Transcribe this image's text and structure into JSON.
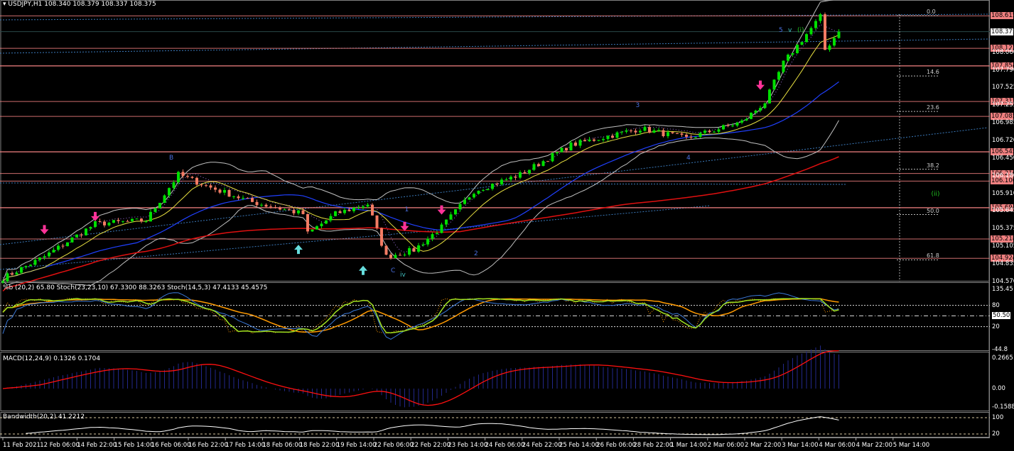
{
  "header": {
    "symbol": "USDJPY,H1",
    "open": "108.340",
    "high": "108.379",
    "low": "108.337",
    "close": "108.375"
  },
  "indicators": {
    "stoch_label": "%b (20,2) 65.80  Stoch(23,23,10) 67.3300 88.3263  Stoch(14,5,3) 47.4133 45.4575",
    "macd_label": "MACD(12,24,9) 0.1326 0.1704",
    "bandwidth_label": "Bandwidth(20,2) 41.2212"
  },
  "colors": {
    "bull": "#00e000",
    "bear": "#f47c64",
    "level": "#f08080",
    "ma_fast": "#e8e040",
    "ma_mid": "#2040ff",
    "ma_slow": "#e01010",
    "bands": "#c0c0c0",
    "stoch_k": "#a0e020",
    "stoch_d": "#ff9a00",
    "macd_hist": "#22288a",
    "macd_signal": "#ff1010",
    "arrow_down": "#ff3399",
    "arrow_up": "#66dddd"
  },
  "chart_data": {
    "type": "candlestick",
    "title": "USDJPY,H1",
    "ylim": [
      104.57,
      108.7
    ],
    "bars": 182,
    "close_path": [
      {
        "bar": 0,
        "price": 104.62
      },
      {
        "bar": 9,
        "price": 104.95
      },
      {
        "bar": 20,
        "price": 105.45
      },
      {
        "bar": 31,
        "price": 105.5
      },
      {
        "bar": 38,
        "price": 106.2
      },
      {
        "bar": 45,
        "price": 106.0
      },
      {
        "bar": 54,
        "price": 105.78
      },
      {
        "bar": 65,
        "price": 105.6
      },
      {
        "bar": 66,
        "price": 105.3
      },
      {
        "bar": 72,
        "price": 105.6
      },
      {
        "bar": 79,
        "price": 105.75
      },
      {
        "bar": 83,
        "price": 104.95
      },
      {
        "bar": 89,
        "price": 105.05
      },
      {
        "bar": 95,
        "price": 105.4
      },
      {
        "bar": 102,
        "price": 105.95
      },
      {
        "bar": 112,
        "price": 106.2
      },
      {
        "bar": 123,
        "price": 106.65
      },
      {
        "bar": 138,
        "price": 106.9
      },
      {
        "bar": 148,
        "price": 106.75
      },
      {
        "bar": 160,
        "price": 107.0
      },
      {
        "bar": 165,
        "price": 107.3
      },
      {
        "bar": 169,
        "price": 107.9
      },
      {
        "bar": 177,
        "price": 108.6
      },
      {
        "bar": 178,
        "price": 108.1
      },
      {
        "bar": 181,
        "price": 108.375
      }
    ],
    "price_ticks": [
      "108.375",
      "108.060",
      "107.790",
      "107.525",
      "107.255",
      "106.985",
      "106.720",
      "106.450",
      "106.180",
      "105.910",
      "105.645",
      "105.375",
      "105.105",
      "104.835",
      "104.570"
    ],
    "levels": [
      "108.615",
      "108.122",
      "107.854",
      "107.312",
      "107.085",
      "106.545",
      "106.216",
      "106.100",
      "105.694",
      "105.218",
      "104.924"
    ],
    "current_price": "108.375",
    "fib_levels": [
      "0.0",
      "14.6",
      "23.6",
      "38.2",
      "50.0",
      "61.8"
    ],
    "fib_prices": [
      108.62,
      107.7,
      107.16,
      106.28,
      105.59,
      104.9
    ],
    "time_labels": [
      "11 Feb 2021",
      "12 Feb 06:00",
      "14 Feb 22:00",
      "15 Feb 14:00",
      "16 Feb 06:00",
      "16 Feb 22:00",
      "17 Feb 14:00",
      "18 Feb 06:00",
      "18 Feb 22:00",
      "19 Feb 14:00",
      "22 Feb 06:00",
      "22 Feb 22:00",
      "23 Feb 14:00",
      "24 Feb 06:00",
      "24 Feb 22:00",
      "25 Feb 14:00",
      "26 Feb 06:00",
      "28 Feb 22:00",
      "1 Mar 14:00",
      "2 Mar 06:00",
      "2 Mar 22:00",
      "3 Mar 14:00",
      "4 Mar 06:00",
      "4 Mar 22:00",
      "5 Mar 14:00"
    ],
    "wave_labels": [
      {
        "text": "B",
        "bar": 36,
        "price": 106.5,
        "color": "#4a6fe0"
      },
      {
        "text": "1",
        "bar": 87,
        "price": 105.72,
        "color": "#4a6fe0"
      },
      {
        "text": "2",
        "bar": 102,
        "price": 105.05,
        "color": "#4a6fe0"
      },
      {
        "text": "C",
        "bar": 84,
        "price": 104.79,
        "color": "#4a6fe0"
      },
      {
        "text": "iv",
        "bar": 86,
        "price": 104.72,
        "color": "#40c0c0"
      },
      {
        "text": "3",
        "bar": 137,
        "price": 107.3,
        "color": "#4a6fe0"
      },
      {
        "text": "4",
        "bar": 148,
        "price": 106.5,
        "color": "#4a6fe0"
      },
      {
        "text": "5",
        "bar": 168,
        "price": 108.45,
        "color": "#4a6fe0"
      },
      {
        "text": "v",
        "bar": 170,
        "price": 108.45,
        "color": "#40c0c0"
      },
      {
        "text": "(i)",
        "bar": 172,
        "price": 108.45,
        "color": "#20c020"
      },
      {
        "text": "(ii)",
        "bar": 201,
        "price": 105.95,
        "color": "#20c020"
      }
    ],
    "down_arrows": [
      {
        "bar": 9,
        "price": 105.3
      },
      {
        "bar": 20,
        "price": 105.5
      },
      {
        "bar": 87,
        "price": 105.35
      },
      {
        "bar": 95,
        "price": 105.6
      },
      {
        "bar": 164,
        "price": 107.5
      }
    ],
    "up_arrows": [
      {
        "bar": 64,
        "price": 105.12
      },
      {
        "bar": 78,
        "price": 104.8
      }
    ],
    "stoch_ticks": [
      "135.45",
      "80",
      "50.50",
      "20",
      "-44.8"
    ],
    "macd_ticks": [
      "0.2665",
      "0.00",
      "-0.1588"
    ],
    "bandwidth_ticks": [
      "100",
      "20"
    ]
  }
}
